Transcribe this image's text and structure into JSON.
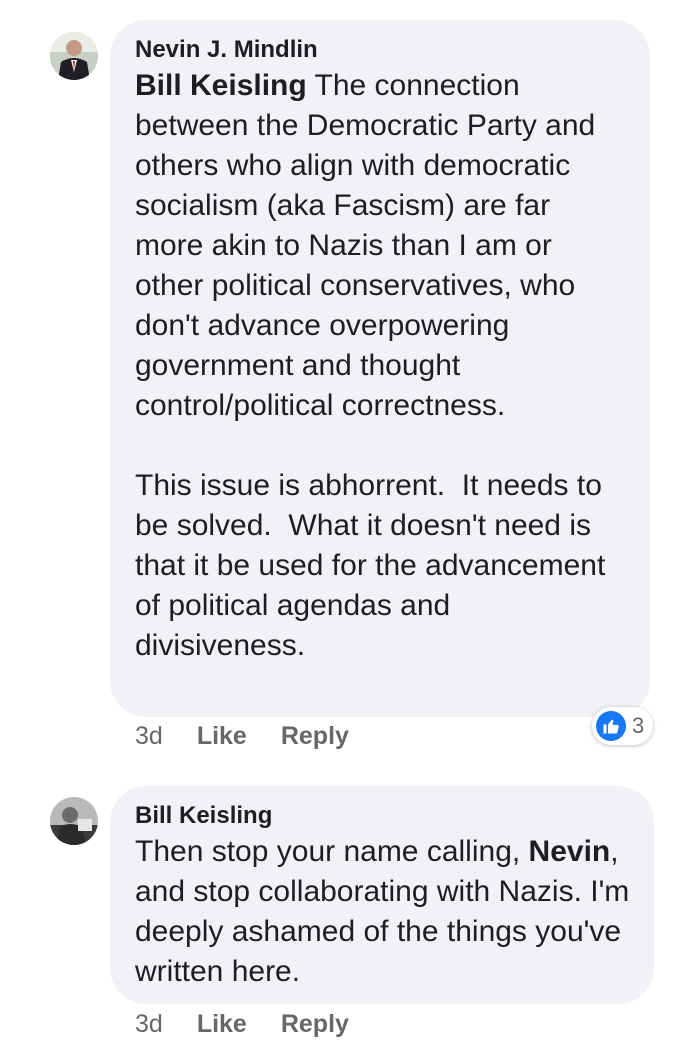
{
  "comments": [
    {
      "author": "Nevin J. Mindlin",
      "mention": "Bill Keisling",
      "text_after_mention": " The connection between the Democratic Party and others who align with democratic socialism (aka Fascism) are far more akin to Nazis than I am or other political conservatives, who don't advance overpowering government and thought control/political correctness.",
      "paragraph2": "This issue is abhorrent.  It needs to be solved.  What it doesn't need is that it be used for the advancement of political agendas and divisiveness.",
      "time": "3d",
      "like_label": "Like",
      "reply_label": "Reply",
      "reaction_icon": "thumbs-up-icon",
      "reaction_count": "3"
    },
    {
      "author": "Bill Keisling",
      "text_before_mention": "Then stop your name calling, ",
      "mention": "Nevin",
      "text_after_mention": ", and stop collaborating with Nazis. I'm deeply ashamed of the things you've written here.",
      "time": "3d",
      "like_label": "Like",
      "reply_label": "Reply"
    }
  ],
  "colors": {
    "bubble_bg": "#f0f2f5",
    "text": "#1c1e21",
    "secondary_text": "#65676b",
    "like_blue": "#1877f2"
  }
}
